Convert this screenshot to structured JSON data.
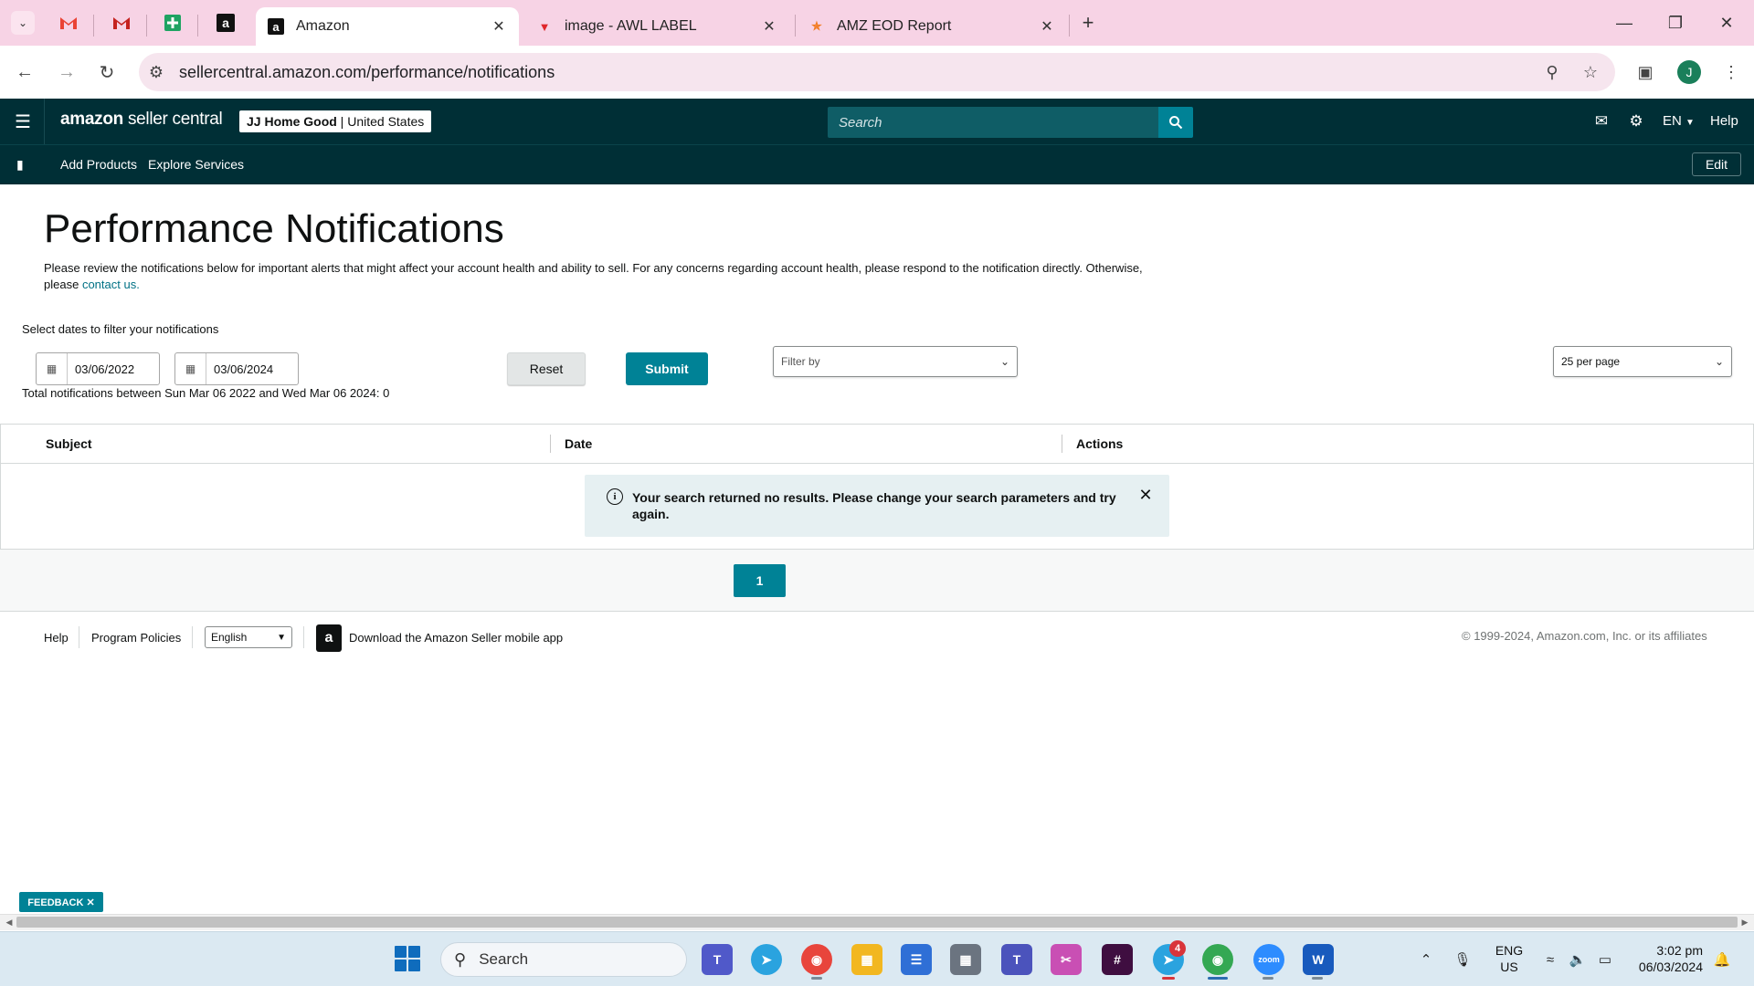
{
  "browser": {
    "tabs": [
      {
        "label": "Amazon",
        "active": true
      },
      {
        "label": "image - AWL LABEL",
        "active": false
      },
      {
        "label": "AMZ EOD Report",
        "active": false
      }
    ],
    "url": "sellercentral.amazon.com/performance/notifications",
    "profile_initial": "J"
  },
  "header": {
    "logo_brand": "amazon",
    "logo_sub": "seller central",
    "store_name": "JJ Home Good",
    "store_region": "United States",
    "search_placeholder": "Search",
    "language": "EN",
    "help": "Help"
  },
  "nav": {
    "items": [
      "Add Products",
      "Explore Services"
    ],
    "edit_label": "Edit"
  },
  "page": {
    "title": "Performance Notifications",
    "description": "Please review the notifications below for important alerts that might affect your account health and ability to sell. For any concerns regarding account health, please respond to the notification directly. Otherwise, please",
    "contact_link": "contact us.",
    "filter_label": "Select dates to filter your notifications",
    "date_from": "03/06/2022",
    "date_to": "03/06/2024",
    "total_text": "Total notifications between Sun Mar 06 2022 and Wed Mar 06 2024: 0",
    "reset_label": "Reset",
    "submit_label": "Submit",
    "filter_by_placeholder": "Filter by",
    "per_page": "25 per page"
  },
  "table": {
    "columns": [
      "Subject",
      "Date",
      "Actions"
    ],
    "empty_message": "Your search returned no results. Please change your search parameters and try again."
  },
  "pagination": {
    "current_page": "1"
  },
  "footer": {
    "help": "Help",
    "program_policies": "Program Policies",
    "language": "English",
    "app_download": "Download the Amazon Seller mobile app",
    "copyright": "© 1999-2024, Amazon.com, Inc. or its affiliates"
  },
  "feedback": {
    "label": "FEEDBACK ✕"
  },
  "taskbar": {
    "search_placeholder": "Search",
    "telegram_badge": "4",
    "lang_line1": "ENG",
    "lang_line2": "US",
    "time": "3:02 pm",
    "date": "06/03/2024"
  },
  "colors": {
    "header_bg": "#002f36",
    "accent": "#008296",
    "tab_strip": "#f7d3e5"
  }
}
